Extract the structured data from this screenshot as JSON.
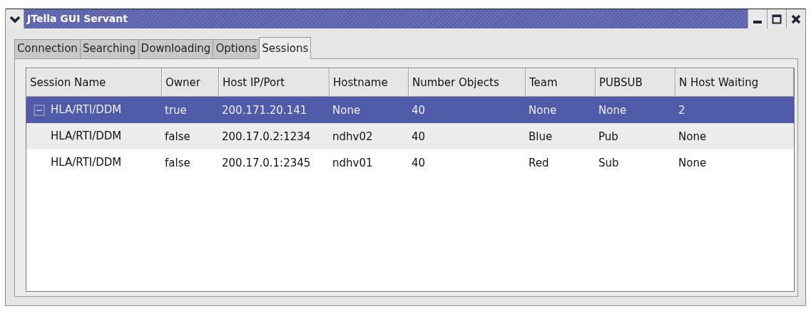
{
  "window": {
    "title": "JTella GUI Servant"
  },
  "tabs": [
    {
      "label": "Connection",
      "selected": false
    },
    {
      "label": "Searching",
      "selected": false
    },
    {
      "label": "Downloading",
      "selected": false
    },
    {
      "label": "Options",
      "selected": false
    },
    {
      "label": "Sessions",
      "selected": true
    }
  ],
  "table": {
    "columns": [
      "Session Name",
      "Owner",
      "Host IP/Port",
      "Hostname",
      "Number Objects",
      "Team",
      "PUBSUB",
      "N Host Waiting"
    ],
    "rows": [
      {
        "selected": true,
        "expanded": true,
        "cells": [
          "HLA/RTI/DDM",
          "true",
          "200.171.20.141",
          "None",
          "40",
          "None",
          "None",
          "2"
        ]
      },
      {
        "selected": false,
        "cells": [
          "HLA/RTI/DDM",
          "false",
          "200.17.0.2:1234",
          "ndhv02",
          "40",
          "Blue",
          "Pub",
          "None"
        ]
      },
      {
        "selected": false,
        "cells": [
          "HLA/RTI/DDM",
          "false",
          "200.17.0.1:2345",
          "ndhv01",
          "40",
          "Red",
          "Sub",
          "None"
        ]
      }
    ]
  }
}
